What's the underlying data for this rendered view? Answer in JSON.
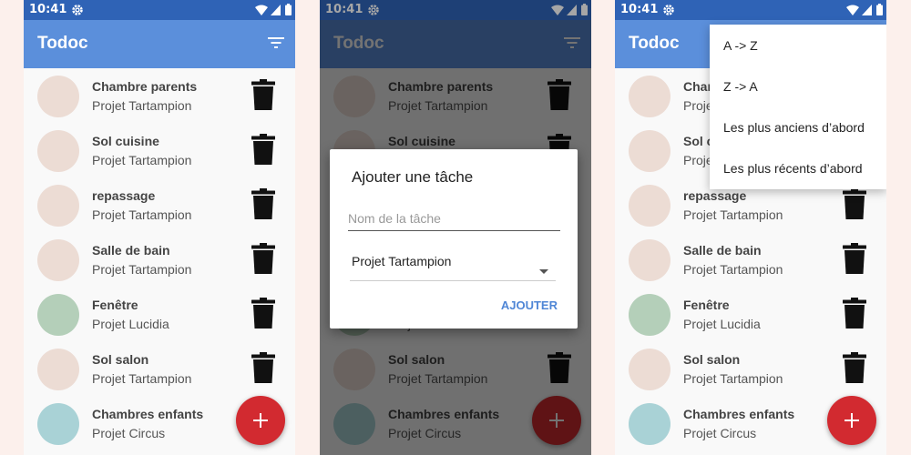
{
  "status": {
    "time": "10:41"
  },
  "appbar": {
    "title": "Todoc"
  },
  "tasks": [
    {
      "name": "Chambre parents",
      "project": "Projet Tartampion",
      "color": "#ecdcd4"
    },
    {
      "name": "Sol cuisine",
      "project": "Projet Tartampion",
      "color": "#ecdcd4"
    },
    {
      "name": "repassage",
      "project": "Projet Tartampion",
      "color": "#ecdcd4"
    },
    {
      "name": "Salle de bain",
      "project": "Projet Tartampion",
      "color": "#ecdcd4"
    },
    {
      "name": "Fenêtre",
      "project": "Projet Lucidia",
      "color": "#b4cfb9"
    },
    {
      "name": "Sol salon",
      "project": "Projet Tartampion",
      "color": "#ecdcd4"
    },
    {
      "name": "Chambres enfants",
      "project": "Projet Circus",
      "color": "#a9d2d6"
    }
  ],
  "dialog": {
    "title": "Ajouter une tâche",
    "name_placeholder": "Nom de la tâche",
    "project_selected": "Projet Tartampion",
    "add_label": "AJOUTER"
  },
  "sort_menu": {
    "items": [
      "A -> Z",
      "Z -> A",
      "Les plus anciens d’abord",
      "Les plus récents d’abord"
    ]
  },
  "colors": {
    "status_bar": "#2f63b6",
    "app_bar": "#5b8fdb",
    "fab": "#d22a30",
    "accent": "#4f86d6"
  },
  "icons": {
    "settings": "gear-icon",
    "wifi": "wifi-icon",
    "signal": "signal-icon",
    "battery": "battery-icon",
    "sort": "filter-list-icon",
    "delete": "trash-icon",
    "add": "plus-icon",
    "dropdown": "dropdown-arrow-icon"
  }
}
